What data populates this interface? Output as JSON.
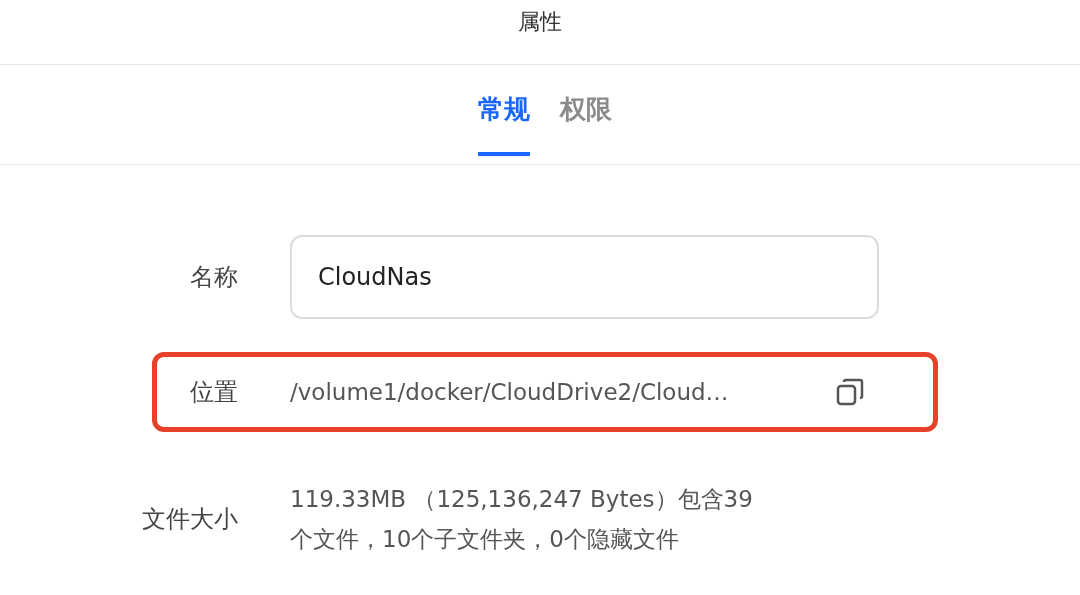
{
  "dialog": {
    "title": "属性"
  },
  "tabs": [
    {
      "label": "常规",
      "selected": true
    },
    {
      "label": "权限",
      "selected": false
    }
  ],
  "fields": [
    {
      "kind": "input",
      "label": "名称",
      "value": "CloudNas",
      "highlighted": false
    },
    {
      "kind": "path",
      "label": "位置",
      "value": "/volume1/docker/CloudDrive2/Cloud…",
      "highlighted": true
    },
    {
      "kind": "text",
      "label": "文件大小",
      "value": "119.33MB （125,136,247 Bytes）包含39个文件，10个子文件夹，0个隐藏文件",
      "highlighted": false
    }
  ]
}
